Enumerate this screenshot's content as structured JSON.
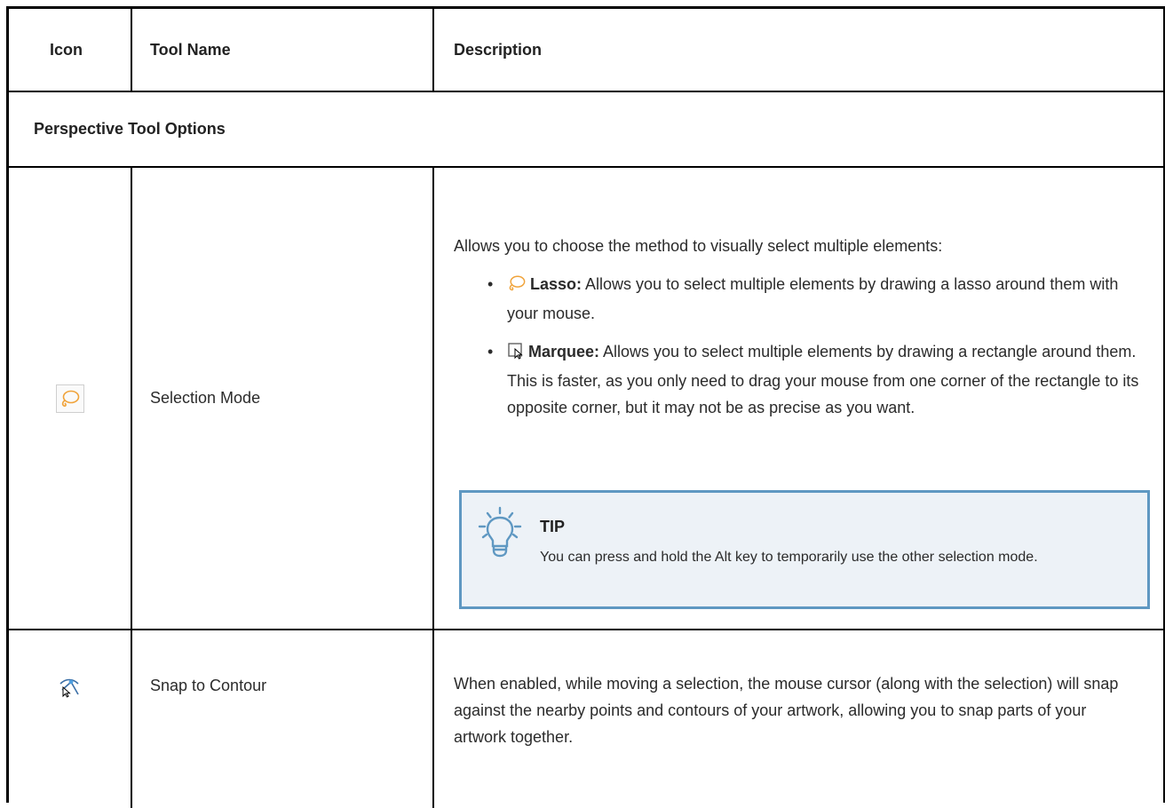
{
  "table": {
    "headers": {
      "icon": "Icon",
      "tool_name": "Tool Name",
      "description": "Description"
    },
    "section_title": "Perspective Tool Options",
    "rows": [
      {
        "icon": "lasso-icon",
        "tool_name": "Selection Mode",
        "description_intro": "Allows you to choose the method to visually select multiple elements:",
        "options": [
          {
            "icon": "lasso-icon",
            "label": "Lasso:",
            "text": "Allows you to select multiple elements by drawing a lasso around them with your mouse."
          },
          {
            "icon": "marquee-icon",
            "label": "Marquee:",
            "text": "Allows you to select multiple elements by drawing a rectangle around them. This is faster, as you only need to drag your mouse from one corner of the rectangle to its opposite corner, but it may not be as precise as you want."
          }
        ],
        "tip": {
          "icon": "lightbulb-icon",
          "title": "TIP",
          "text": "You can press and hold the Alt key to temporarily use the other selection mode."
        }
      },
      {
        "icon": "snap-to-contour-icon",
        "tool_name": "Snap to Contour",
        "description": "When enabled, while moving a selection, the mouse cursor (along with the selection) will snap against the nearby points and contours of your artwork, allowing you to snap parts of your artwork together."
      }
    ]
  },
  "colors": {
    "lasso": "#f0a33a",
    "tip_border": "#5f98c2",
    "tip_bg": "#edf2f7",
    "grid": "#000000"
  }
}
